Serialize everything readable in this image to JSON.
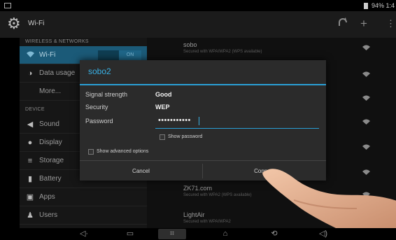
{
  "status_bar": {
    "battery_text": "94% 1:4"
  },
  "action_bar": {
    "title": "Wi-Fi"
  },
  "sidebar": {
    "header_wireless": "WIRELESS & NETWORKS",
    "header_device": "DEVICE",
    "items": [
      {
        "label": "Wi-Fi",
        "icon": "wifi-icon",
        "toggle": "ON"
      },
      {
        "label": "Data usage",
        "icon": "data-usage-icon"
      },
      {
        "label": "More...",
        "icon": ""
      },
      {
        "label": "Sound",
        "icon": "sound-icon"
      },
      {
        "label": "Display",
        "icon": "display-icon"
      },
      {
        "label": "Storage",
        "icon": "storage-icon"
      },
      {
        "label": "Battery",
        "icon": "battery-icon"
      },
      {
        "label": "Apps",
        "icon": "apps-icon"
      },
      {
        "label": "Users",
        "icon": "users-icon"
      }
    ]
  },
  "networks": [
    {
      "name": "sobo",
      "status": "Secured with WPA/WPA2 (WPS available)"
    },
    {
      "name": "ZK71.com",
      "status": "Secured with WPA2 (WPS available)"
    },
    {
      "name": "LightAir",
      "status": "Secured with WPA/WPA2"
    }
  ],
  "dialog": {
    "title": "sobo2",
    "signal_label": "Signal strength",
    "signal_value": "Good",
    "security_label": "Security",
    "security_value": "WEP",
    "password_label": "Password",
    "password_value": "•••••••••••",
    "show_password": "Show password",
    "show_advanced": "Show advanced options",
    "cancel": "Cancel",
    "connect": "Connect"
  },
  "colors": {
    "accent": "#2a9fd6",
    "selected": "#1b5a78"
  }
}
